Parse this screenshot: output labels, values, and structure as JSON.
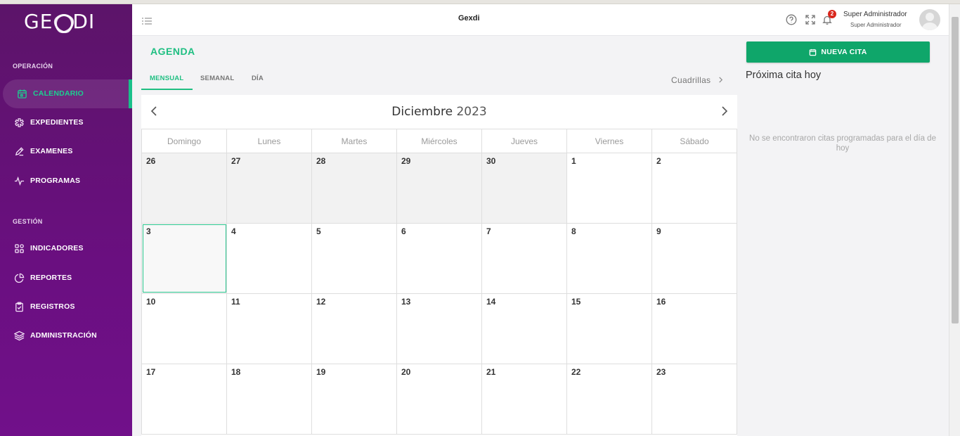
{
  "brand": {
    "logo_left": "GE",
    "logo_right": "DI"
  },
  "sidebar": {
    "sections": [
      {
        "title": "OPERACIÓN",
        "items": [
          {
            "label": "CALENDARIO",
            "icon": "calendar-icon",
            "active": true
          },
          {
            "label": "EXPEDIENTES",
            "icon": "asterisk-icon"
          },
          {
            "label": "EXAMENES",
            "icon": "pen-icon"
          },
          {
            "label": "PROGRAMAS",
            "icon": "activity-icon"
          }
        ]
      },
      {
        "title": "GESTIÓN",
        "items": [
          {
            "label": "INDICADORES",
            "icon": "grid-icon"
          },
          {
            "label": "REPORTES",
            "icon": "pie-chart-icon"
          },
          {
            "label": "REGISTROS",
            "icon": "clipboard-check-icon"
          },
          {
            "label": "ADMINISTRACIÓN",
            "icon": "layers-icon"
          }
        ]
      }
    ]
  },
  "header": {
    "title": "Gexdi",
    "notification_count": "2",
    "user_name": "Super Administrador",
    "user_role": "Super Administrador"
  },
  "main": {
    "page_title": "AGENDA",
    "tabs": [
      {
        "label": "MENSUAL",
        "active": true
      },
      {
        "label": "SEMANAL"
      },
      {
        "label": "DÍA"
      }
    ],
    "cuadrillas_label": "Cuadrillas",
    "calendar": {
      "month_name": "Diciembre",
      "year": "2023",
      "weekdays": [
        "Domingo",
        "Lunes",
        "Martes",
        "Miércoles",
        "Jueves",
        "Viernes",
        "Sábado"
      ],
      "weeks": [
        [
          "26",
          "27",
          "28",
          "29",
          "30",
          "1",
          "2"
        ],
        [
          "3",
          "4",
          "5",
          "6",
          "7",
          "8",
          "9"
        ],
        [
          "10",
          "11",
          "12",
          "13",
          "14",
          "15",
          "16"
        ],
        [
          "17",
          "18",
          "19",
          "20",
          "21",
          "22",
          "23"
        ]
      ],
      "other_month_cells": [
        [
          0,
          0
        ],
        [
          0,
          1
        ],
        [
          0,
          2
        ],
        [
          0,
          3
        ],
        [
          0,
          4
        ]
      ],
      "today_cell": [
        1,
        0
      ]
    }
  },
  "right_panel": {
    "new_button_label": "NUEVA CITA",
    "next_title": "Próxima cita hoy",
    "no_appointments": "No se encontraron citas programadas para el día de hoy"
  },
  "colors": {
    "accent": "#1fbf82",
    "button": "#0fa66a",
    "sidebar": "#6a0f80",
    "badge": "#d9271d"
  }
}
